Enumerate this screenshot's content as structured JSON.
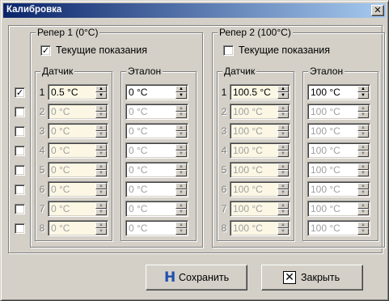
{
  "window": {
    "title": "Калибровка",
    "close_glyph": "✕"
  },
  "row_enable": {
    "checked": [
      true,
      false,
      false,
      false,
      false,
      false,
      false,
      false
    ]
  },
  "groups": [
    {
      "legend": "Репер 1 (0°C)",
      "current_readings": {
        "label": "Текущие показания",
        "checked": true
      },
      "sensor_label": "Датчик",
      "reference_label": "Эталон",
      "sensor_values": [
        "0.5 °C",
        "0 °C",
        "0 °C",
        "0 °C",
        "0 °C",
        "0 °C",
        "0 °C",
        "0 °C"
      ],
      "reference_values": [
        "0 °C",
        "0 °C",
        "0 °C",
        "0 °C",
        "0 °C",
        "0 °C",
        "0 °C",
        "0 °C"
      ]
    },
    {
      "legend": "Репер 2 (100°C)",
      "current_readings": {
        "label": "Текущие показания",
        "checked": false
      },
      "sensor_label": "Датчик",
      "reference_label": "Эталон",
      "sensor_values": [
        "100.5 °C",
        "100 °C",
        "100 °C",
        "100 °C",
        "100 °C",
        "100 °C",
        "100 °C",
        "100 °C"
      ],
      "reference_values": [
        "100 °C",
        "100 °C",
        "100 °C",
        "100 °C",
        "100 °C",
        "100 °C",
        "100 °C",
        "100 °C"
      ]
    }
  ],
  "row_numbers": [
    "1",
    "2",
    "3",
    "4",
    "5",
    "6",
    "7",
    "8"
  ],
  "buttons": {
    "save": "Сохранить",
    "close": "Закрыть"
  }
}
